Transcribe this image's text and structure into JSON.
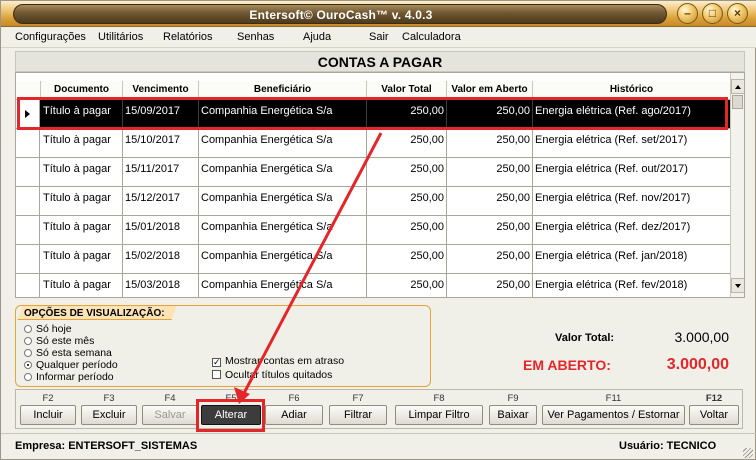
{
  "window": {
    "title": "Entersoft© OuroCash™ v. 4.0.3"
  },
  "menu": [
    {
      "label": "Configurações"
    },
    {
      "label": "Utilitários"
    },
    {
      "label": "Relatórios"
    },
    {
      "label": "Senhas"
    },
    {
      "label": "Ajuda"
    },
    {
      "label": "Sair"
    },
    {
      "label": "Calculadora"
    }
  ],
  "page": {
    "title": "CONTAS A PAGAR"
  },
  "table": {
    "columns": [
      "Documento",
      "Vencimento",
      "Beneficiário",
      "Valor Total",
      "Valor em Aberto",
      "Histórico"
    ],
    "rows": [
      [
        "Título à pagar",
        "15/09/2017",
        "Companhia Energética S/a",
        "250,00",
        "250,00",
        "Energia elétrica (Ref. ago/2017)"
      ],
      [
        "Título à pagar",
        "15/10/2017",
        "Companhia Energética S/a",
        "250,00",
        "250,00",
        "Energia elétrica (Ref. set/2017)"
      ],
      [
        "Título à pagar",
        "15/11/2017",
        "Companhia Energética S/a",
        "250,00",
        "250,00",
        "Energia elétrica (Ref. out/2017)"
      ],
      [
        "Título à pagar",
        "15/12/2017",
        "Companhia Energética S/a",
        "250,00",
        "250,00",
        "Energia elétrica (Ref. nov/2017)"
      ],
      [
        "Título à pagar",
        "15/01/2018",
        "Companhia Energética S/a",
        "250,00",
        "250,00",
        "Energia elétrica (Ref. dez/2017)"
      ],
      [
        "Título à pagar",
        "15/02/2018",
        "Companhia Energética S/a",
        "250,00",
        "250,00",
        "Energia elétrica (Ref. jan/2018)"
      ],
      [
        "Título à pagar",
        "15/03/2018",
        "Companhia Energética S/a",
        "250,00",
        "250,00",
        "Energia elétrica (Ref. fev/2018)"
      ]
    ],
    "selected_row": 0
  },
  "options": {
    "title": "OPÇÕES DE VISUALIZAÇÃO:",
    "radios": [
      {
        "label": "Só hoje",
        "checked": false
      },
      {
        "label": "Só este mês",
        "checked": false
      },
      {
        "label": "Só esta semana",
        "checked": false
      },
      {
        "label": "Qualquer período",
        "checked": true
      },
      {
        "label": "Informar período",
        "checked": false
      }
    ],
    "checks": [
      {
        "label": "Mostrar contas em atraso",
        "checked": true
      },
      {
        "label": "Ocultar títulos quitados",
        "checked": false
      }
    ]
  },
  "totals": {
    "total_label": "Valor Total:",
    "total_value": "3.000,00",
    "open_label": "EM ABERTO:",
    "open_value": "3.000,00",
    "open_color": "#e3262a"
  },
  "buttons": [
    {
      "key": "F2",
      "label": "Incluir",
      "disabled": false
    },
    {
      "key": "F3",
      "label": "Excluir",
      "disabled": false
    },
    {
      "key": "F4",
      "label": "Salvar",
      "disabled": true
    },
    {
      "key": "F5",
      "label": "Alterar",
      "disabled": false,
      "active": true
    },
    {
      "key": "F6",
      "label": "Adiar",
      "disabled": false
    },
    {
      "key": "F7",
      "label": "Filtrar",
      "disabled": false
    },
    {
      "key": "F8",
      "label": "Limpar Filtro",
      "disabled": false
    },
    {
      "key": "F9",
      "label": "Baixar",
      "disabled": false
    },
    {
      "key": "F11",
      "label": "Ver Pagamentos / Estornar",
      "disabled": false
    },
    {
      "key": "F12",
      "label": "Voltar",
      "disabled": false
    }
  ],
  "status": {
    "company": "Empresa: ENTERSOFT_SISTEMAS",
    "user": "Usuário: TECNICO"
  },
  "highlight_color": "#e3262a"
}
